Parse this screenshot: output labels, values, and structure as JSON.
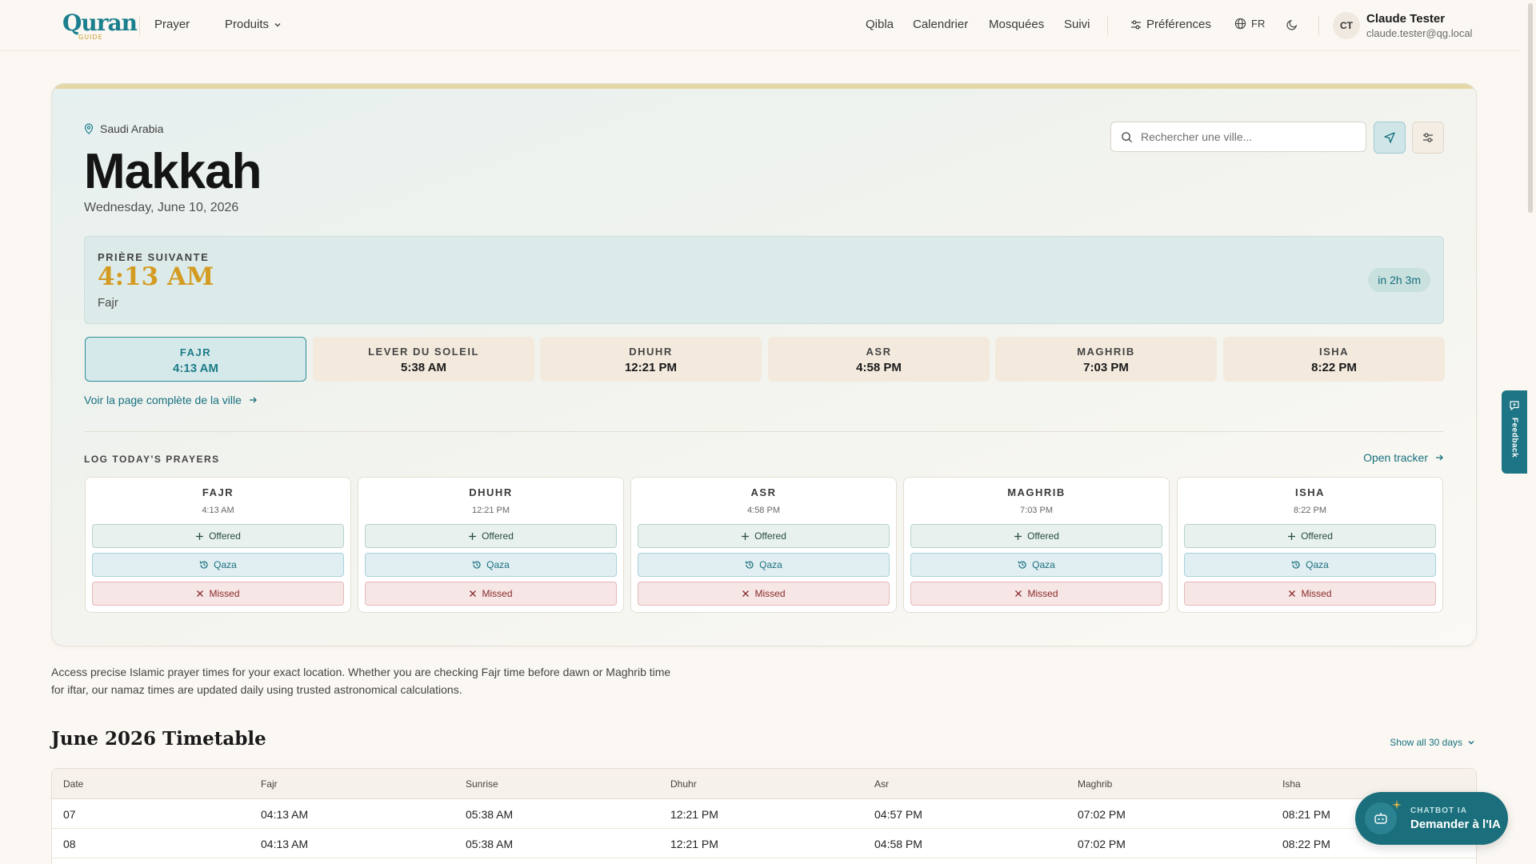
{
  "header": {
    "logo_text": "Quran",
    "logo_sub": "GUIDE",
    "nav_left": [
      "Prayer",
      "Produits"
    ],
    "nav_right": [
      "Qibla",
      "Calendrier",
      "Mosquées",
      "Suivi"
    ],
    "preferences": "Préférences",
    "language": "FR",
    "user": {
      "initials": "CT",
      "name": "Claude Tester",
      "email": "claude.tester@qg.local"
    }
  },
  "location": {
    "country": "Saudi Arabia",
    "city": "Makkah",
    "date": "Wednesday, June 10, 2026"
  },
  "search": {
    "placeholder": "Rechercher une ville..."
  },
  "next_prayer": {
    "label": "PRIÈRE SUIVANTE",
    "time": "4:13 AM",
    "name": "Fajr",
    "countdown": "in 2h 3m"
  },
  "prayer_tiles": [
    {
      "name": "FAJR",
      "time": "4:13 AM",
      "active": true
    },
    {
      "name": "LEVER DU SOLEIL",
      "time": "5:38 AM"
    },
    {
      "name": "DHUHR",
      "time": "12:21 PM"
    },
    {
      "name": "ASR",
      "time": "4:58 PM"
    },
    {
      "name": "MAGHRIB",
      "time": "7:03 PM"
    },
    {
      "name": "ISHA",
      "time": "8:22 PM"
    }
  ],
  "city_link": "Voir la page complète de la ville",
  "log": {
    "title": "LOG TODAY'S PRAYERS",
    "open_tracker": "Open tracker",
    "buttons": {
      "offered": "Offered",
      "qaza": "Qaza",
      "missed": "Missed"
    },
    "prayers": [
      {
        "name": "FAJR",
        "time": "4:13 AM"
      },
      {
        "name": "DHUHR",
        "time": "12:21 PM"
      },
      {
        "name": "ASR",
        "time": "4:58 PM"
      },
      {
        "name": "MAGHRIB",
        "time": "7:03 PM"
      },
      {
        "name": "ISHA",
        "time": "8:22 PM"
      }
    ]
  },
  "intro": "Access precise Islamic prayer times for your exact location. Whether you are checking Fajr time before dawn or Maghrib time for iftar, our namaz times are updated daily using trusted astronomical calculations.",
  "timetable": {
    "title": "June 2026 Timetable",
    "show_all": "Show all 30 days",
    "columns": [
      "Date",
      "Fajr",
      "Sunrise",
      "Dhuhr",
      "Asr",
      "Maghrib",
      "Isha"
    ],
    "rows": [
      [
        "07",
        "04:13 AM",
        "05:38 AM",
        "12:21 PM",
        "04:57 PM",
        "07:02 PM",
        "08:21 PM"
      ],
      [
        "08",
        "04:13 AM",
        "05:38 AM",
        "12:21 PM",
        "04:58 PM",
        "07:02 PM",
        "08:22 PM"
      ]
    ]
  },
  "feedback": "Feedback",
  "chatbot": {
    "small": "CHATBOT IA",
    "big": "Demander à l'IA"
  },
  "colors": {
    "accent": "#1b6f7c",
    "gold": "#d49b22",
    "background": "#fbf8f3"
  }
}
